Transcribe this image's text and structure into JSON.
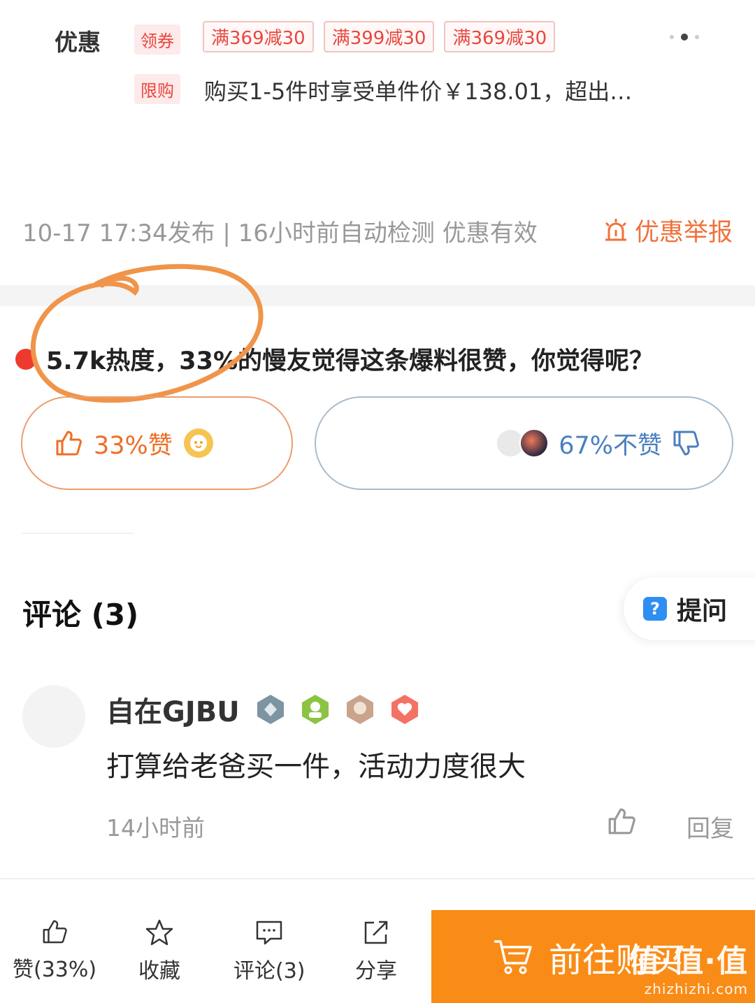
{
  "coupons": {
    "title": "优惠",
    "get_tag": "领券",
    "items": [
      "满369减30",
      "满399减30",
      "满369减30"
    ],
    "limit_tag": "限购",
    "limit_text": "购买1-5件时享受单件价￥138.01，超出…"
  },
  "publish_info": "10-17 17:34发布 | 16小时前自动检测 优惠有效",
  "report_label": "优惠举报",
  "vote": {
    "heat_text": "5.7k热度，33%的慢友觉得这条爆料很赞，你觉得呢？",
    "like_label": "33%赞",
    "like_percent": 33,
    "dislike_label": "67%不赞",
    "dislike_percent": 67
  },
  "comments": {
    "title": "评论 (3)",
    "ask_label": "提问",
    "items": [
      {
        "user": "自在GJBU",
        "text": "打算给老爸买一件，活动力度很大",
        "time": "14小时前",
        "reply_label": "回复"
      }
    ]
  },
  "bottom_bar": {
    "like": "赞(33%)",
    "favorite": "收藏",
    "comment": "评论(3)",
    "share": "分享",
    "buy": "前往购买"
  },
  "watermark": {
    "main": "值·值·值",
    "sub": "zhizhizhi.com"
  },
  "colors": {
    "accent_orange": "#f98c17",
    "like_orange": "#ef6d24",
    "dislike_blue": "#4a7fc0",
    "tag_red": "#e9463f"
  }
}
